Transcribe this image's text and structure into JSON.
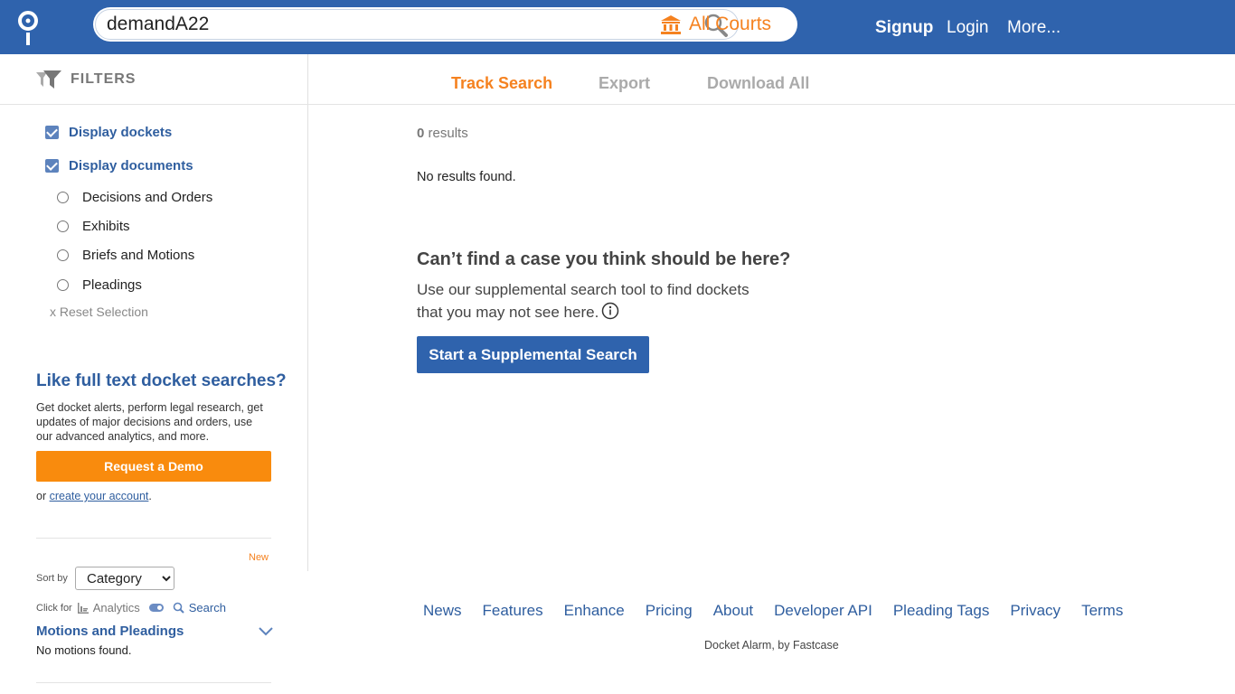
{
  "header": {
    "search": {
      "value": "demandA22",
      "placeholder": ""
    },
    "courts_label": "All Courts",
    "nav": {
      "signup": "Signup",
      "login": "Login",
      "more": "More..."
    }
  },
  "sidebar": {
    "filters_label": "FILTERS",
    "checkboxes": [
      {
        "label": "Display dockets",
        "checked": true
      },
      {
        "label": "Display documents",
        "checked": true
      }
    ],
    "doc_types": [
      {
        "label": "Decisions and Orders"
      },
      {
        "label": "Exhibits"
      },
      {
        "label": "Briefs and Motions"
      },
      {
        "label": "Pleadings"
      }
    ],
    "reset_label": "x Reset Selection",
    "promo": {
      "title": "Like full text docket searches?",
      "text": "Get docket alerts, perform legal research, get updates of major decisions and orders, use our advanced analytics, and more.",
      "button": "Request a Demo",
      "or_prefix": "or ",
      "account_link": "create your account",
      "or_suffix": "."
    },
    "new_badge": "New",
    "sort": {
      "label": "Sort by",
      "selected": "Category"
    },
    "click_for": {
      "label": "Click for",
      "analytics": "Analytics",
      "search": "Search"
    },
    "motions": {
      "title": "Motions and Pleadings",
      "empty": "No motions found."
    }
  },
  "main": {
    "tabs": {
      "track": "Track Search",
      "export": "Export",
      "download": "Download All"
    },
    "results": {
      "count": "0",
      "suffix": " results",
      "empty": "No results found."
    },
    "supplemental": {
      "heading": "Can’t find a case you think should be here?",
      "text": "Use our supplemental search tool to find dockets that you may not see here.",
      "button": "Start a Supplemental Search"
    }
  },
  "footer": {
    "links": [
      "News",
      "Features",
      "Enhance",
      "Pricing",
      "About",
      "Developer API",
      "Pleading Tags",
      "Privacy",
      "Terms"
    ],
    "credit": "Docket Alarm, by Fastcase"
  },
  "colors": {
    "brand_blue": "#2f63ad",
    "accent_orange": "#f58220",
    "demo_orange": "#f98b0d"
  }
}
